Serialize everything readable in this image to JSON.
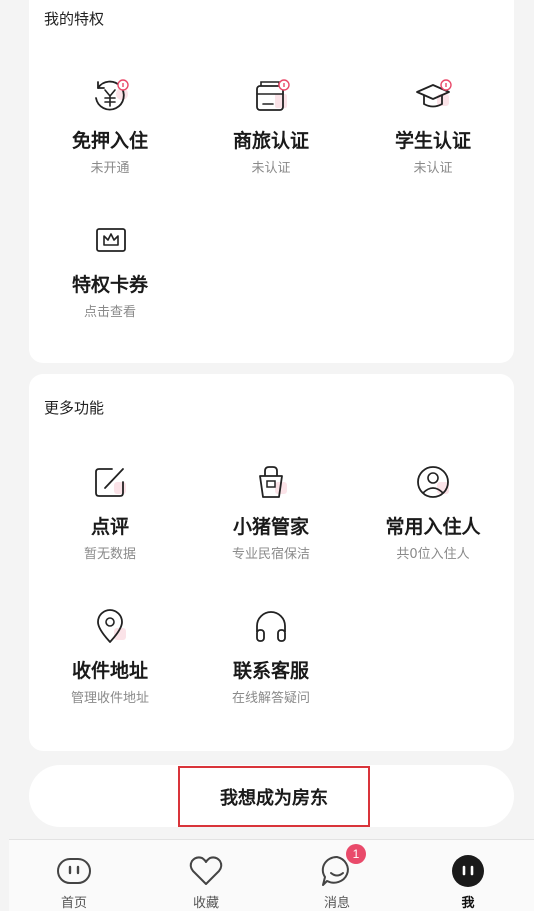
{
  "privileges": {
    "title": "我的特权",
    "items": [
      {
        "label": "免押入住",
        "sub": "未开通"
      },
      {
        "label": "商旅认证",
        "sub": "未认证"
      },
      {
        "label": "学生认证",
        "sub": "未认证"
      },
      {
        "label": "特权卡券",
        "sub": "点击查看"
      }
    ]
  },
  "more": {
    "title": "更多功能",
    "items": [
      {
        "label": "点评",
        "sub": "暂无数据"
      },
      {
        "label": "小猪管家",
        "sub": "专业民宿保洁"
      },
      {
        "label": "常用入住人",
        "sub": "共0位入住人"
      },
      {
        "label": "收件地址",
        "sub": "管理收件地址"
      },
      {
        "label": "联系客服",
        "sub": "在线解答疑问"
      }
    ]
  },
  "landlord_button": "我想成为房东",
  "tabbar": {
    "items": [
      {
        "label": "首页"
      },
      {
        "label": "收藏"
      },
      {
        "label": "消息",
        "badge": "1"
      },
      {
        "label": "我"
      }
    ]
  },
  "colors": {
    "accent": "#e94a6a",
    "highlight_border": "#d9343a"
  }
}
